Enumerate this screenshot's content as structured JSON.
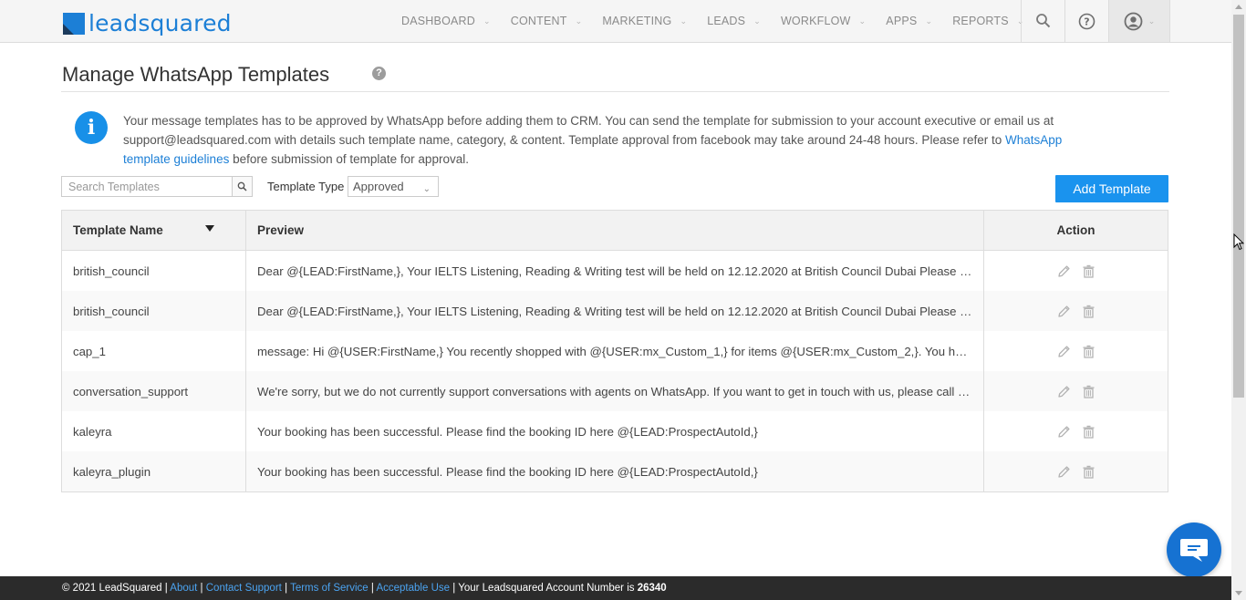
{
  "header": {
    "logo_text": "leadsquared",
    "nav": [
      {
        "label": "DASHBOARD"
      },
      {
        "label": "CONTENT"
      },
      {
        "label": "MARKETING"
      },
      {
        "label": "LEADS"
      },
      {
        "label": "WORKFLOW"
      },
      {
        "label": "APPS"
      },
      {
        "label": "REPORTS"
      }
    ],
    "icons": [
      "search-icon",
      "help-circle-icon",
      "user-account-icon"
    ]
  },
  "page": {
    "title": "Manage WhatsApp Templates",
    "help_icon_glyph": "?"
  },
  "info": {
    "text_before": "Your message templates has to be approved by WhatsApp before adding them to CRM. You can send the template for submission to your account executive or email us at support@leadsquared.com with details such template name, category, & content. Template approval from facebook may take around 24-48 hours. Please refer to ",
    "link_text": "WhatsApp template guidelines",
    "text_after": " before submission of template for approval.",
    "icon_glyph": "i"
  },
  "toolbar": {
    "search_placeholder": "Search Templates",
    "type_label": "Template Type",
    "type_value": "Approved",
    "add_button": "Add Template"
  },
  "table": {
    "columns": {
      "name": "Template Name",
      "preview": "Preview",
      "action": "Action"
    },
    "rows": [
      {
        "name": "british_council",
        "preview": "Dear @{LEAD:FirstName,}, Your IELTS Listening, Reading & Writing test will be held on 12.12.2020 at British Council Dubai Please report..."
      },
      {
        "name": "british_council",
        "preview": "Dear @{LEAD:FirstName,}, Your IELTS Listening, Reading & Writing test will be held on 12.12.2020 at British Council Dubai Please report..."
      },
      {
        "name": "cap_1",
        "preview": "message: Hi @{USER:FirstName,} You recently shopped with @{USER:mx_Custom_1,} for items @{USER:mx_Custom_2,}. You have also e..."
      },
      {
        "name": "conversation_support",
        "preview": "We're sorry, but we do not currently support conversations with agents on WhatsApp. If you want to get in touch with us, please call us..."
      },
      {
        "name": "kaleyra",
        "preview": "Your booking has been successful. Please find the booking ID here @{LEAD:ProspectAutoId,}"
      },
      {
        "name": "kaleyra_plugin",
        "preview": "Your booking has been successful. Please find the booking ID here @{LEAD:ProspectAutoId,}"
      }
    ]
  },
  "footer": {
    "copyright": "© 2021 LeadSquared",
    "links": [
      "About",
      "Contact Support",
      "Terms of Service",
      "Acceptable Use"
    ],
    "account_text": "Your Leadsquared Account Number is",
    "account_number": "26340"
  },
  "colors": {
    "accent": "#1a93ee",
    "brand": "#1c7fd6",
    "footer_bg": "#2b2b2b",
    "chat": "#1672d2"
  }
}
